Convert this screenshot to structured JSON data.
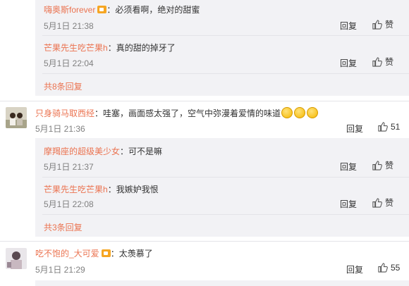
{
  "thread1": {
    "replies": [
      {
        "user": "嗨奥斯forever",
        "text": "：必须看啊，绝对的甜蜜",
        "time": "5月1日 21:38",
        "reply": "回复",
        "like": "赞"
      },
      {
        "user": "芒果先生吃芒果h",
        "text": "：真的甜的掉牙了",
        "time": "5月1日 22:04",
        "reply": "回复",
        "like": "赞"
      }
    ],
    "more": "共8条回复"
  },
  "comment2": {
    "user": "只身骑马取西经",
    "text": "：哇塞，画面感太强了，空气中弥漫着爱情的味道",
    "time": "5月1日 21:36",
    "reply": "回复",
    "likes": "51",
    "replies": [
      {
        "user": "摩羯座的超级美少女",
        "text": "：可不是嘛",
        "time": "5月1日 21:37",
        "reply": "回复",
        "like": "赞"
      },
      {
        "user": "芒果先生吃芒果h",
        "text": "：我嫉妒我恨",
        "time": "5月1日 22:08",
        "reply": "回复",
        "like": "赞"
      }
    ],
    "more": "共3条回复"
  },
  "comment3": {
    "user": "吃不饱的_大可爱",
    "text": "：太羡慕了",
    "time": "5月1日 21:29",
    "reply": "回复",
    "likes": "55"
  },
  "colors": {
    "name": "#eb7350",
    "panel": "#f2f2f5",
    "time": "#808080"
  },
  "icons": [
    "thumb-up-icon",
    "vip-badge-icon",
    "emoji-icon"
  ]
}
